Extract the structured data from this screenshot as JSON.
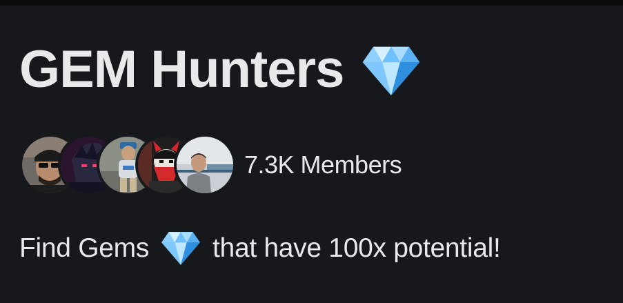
{
  "community": {
    "title": "GEM Hunters",
    "title_icon": "gem-icon",
    "member_count_label": "7.3K Members",
    "description": {
      "before_icon": "Find Gems",
      "icon": "gem-icon",
      "after_icon": "that have 100x potential!"
    },
    "avatars": [
      {
        "name": "member-avatar-1",
        "bg": "#6f6a66"
      },
      {
        "name": "member-avatar-2",
        "bg": "#1a1a2e"
      },
      {
        "name": "member-avatar-3",
        "bg": "#8c8f86"
      },
      {
        "name": "member-avatar-4",
        "bg": "#1f1d1d"
      },
      {
        "name": "member-avatar-5",
        "bg": "#c9cfd4"
      }
    ]
  },
  "colors": {
    "background": "#17181c",
    "text": "#e7e9ea",
    "gem_light": "#bfe6ff",
    "gem_mid": "#5fb8f5",
    "gem_dark": "#2a86d6"
  }
}
